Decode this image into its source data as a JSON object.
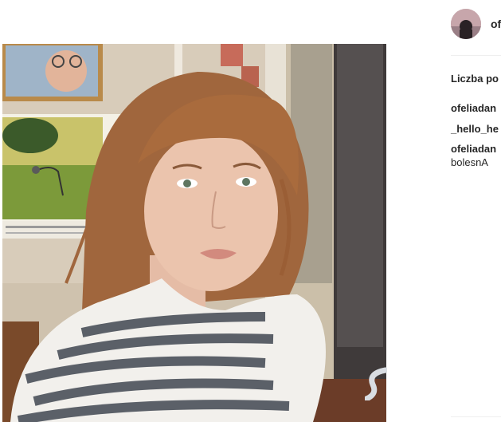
{
  "post": {
    "author_handle": "of",
    "likes_label": "Liczba po",
    "comments": [
      {
        "user": "ofeliadan",
        "text": ""
      },
      {
        "user": "_hello_he",
        "text": ""
      },
      {
        "user": "ofeliadan",
        "text": "bolesnA"
      }
    ]
  },
  "icons": {
    "avatar": "avatar-photo",
    "watermark": "swirl-logo-icon"
  },
  "colors": {
    "text": "#262626",
    "divider": "#efefef",
    "background": "#ffffff"
  }
}
